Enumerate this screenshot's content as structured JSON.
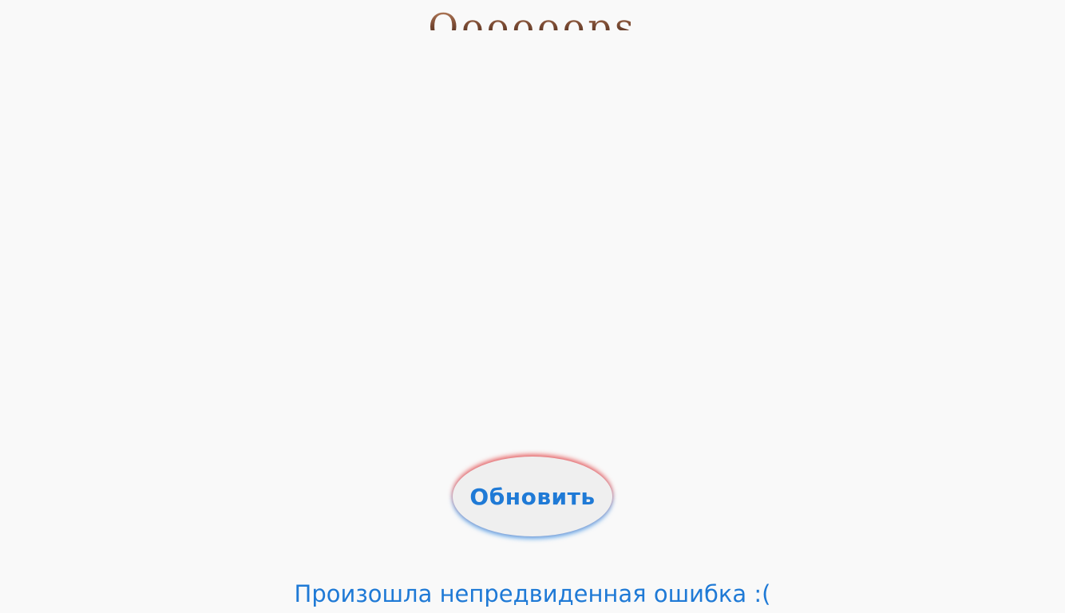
{
  "header": {
    "title": "Oooooops"
  },
  "actions": {
    "refresh_label": "Обновить"
  },
  "message": {
    "text": "Произошла непредвиденная ошибка :("
  },
  "colors": {
    "background": "#f9f9f9",
    "accent_blue": "#1f7ad6",
    "glow_red": "#e84040",
    "glow_blue": "#308ce6",
    "button_bg": "#efefef"
  }
}
